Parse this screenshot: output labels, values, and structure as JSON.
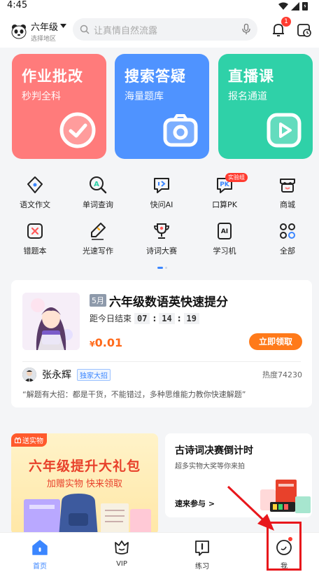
{
  "status_bar": {
    "time": "4:45"
  },
  "header": {
    "grade": "六年级",
    "region_hint": "选择地区",
    "search_placeholder": "让真情自然流露",
    "notification_count": "1"
  },
  "feature_cards": [
    {
      "title": "作业批改",
      "subtitle": "秒判全科",
      "color": "#ff7b7b"
    },
    {
      "title": "搜索答疑",
      "subtitle": "海量题库",
      "color": "#4f93ff"
    },
    {
      "title": "直播课",
      "subtitle": "报名通道",
      "color": "#2fd1a8"
    }
  ],
  "quick_entries": [
    {
      "label": "语文作文",
      "icon": "pen-nib-icon"
    },
    {
      "label": "单词查询",
      "icon": "word-search-icon"
    },
    {
      "label": "快问AI",
      "icon": "ai-chat-icon"
    },
    {
      "label": "口算PK",
      "icon": "pk-icon",
      "tag": "实验组"
    },
    {
      "label": "商城",
      "icon": "shop-icon"
    },
    {
      "label": "错题本",
      "icon": "mistake-book-icon"
    },
    {
      "label": "光速写作",
      "icon": "quick-writing-icon"
    },
    {
      "label": "诗词大赛",
      "icon": "trophy-icon"
    },
    {
      "label": "学习机",
      "icon": "learning-device-icon"
    },
    {
      "label": "全部",
      "icon": "grid-all-icon"
    }
  ],
  "promo": {
    "month": "5月",
    "title": "六年级数语英快速提分",
    "countdown_label": "距今日结束",
    "countdown": [
      "07",
      "14",
      "19"
    ],
    "currency": "¥",
    "price": "0.01",
    "claim_label": "立即领取",
    "author": "张永辉",
    "author_tag": "独家大招",
    "heat": "热度74230",
    "quote": "“解题有大招：都是干货，不能错过，多种思维能力教你快速解题”"
  },
  "gift_card": {
    "tag": "送实物",
    "title": "六年级提升大礼包",
    "subtitle": "加赠实物 快来领取"
  },
  "poem_card": {
    "title": "古诗词决赛倒计时",
    "subtitle": "超多实物大奖等你来拍",
    "link": "速来参与 >"
  },
  "tabbar": [
    {
      "label": "首页",
      "icon": "home-icon",
      "active": true
    },
    {
      "label": "VIP",
      "icon": "vip-icon",
      "active": false
    },
    {
      "label": "练习",
      "icon": "practice-icon",
      "active": false
    },
    {
      "label": "我",
      "icon": "profile-icon",
      "active": false
    }
  ]
}
